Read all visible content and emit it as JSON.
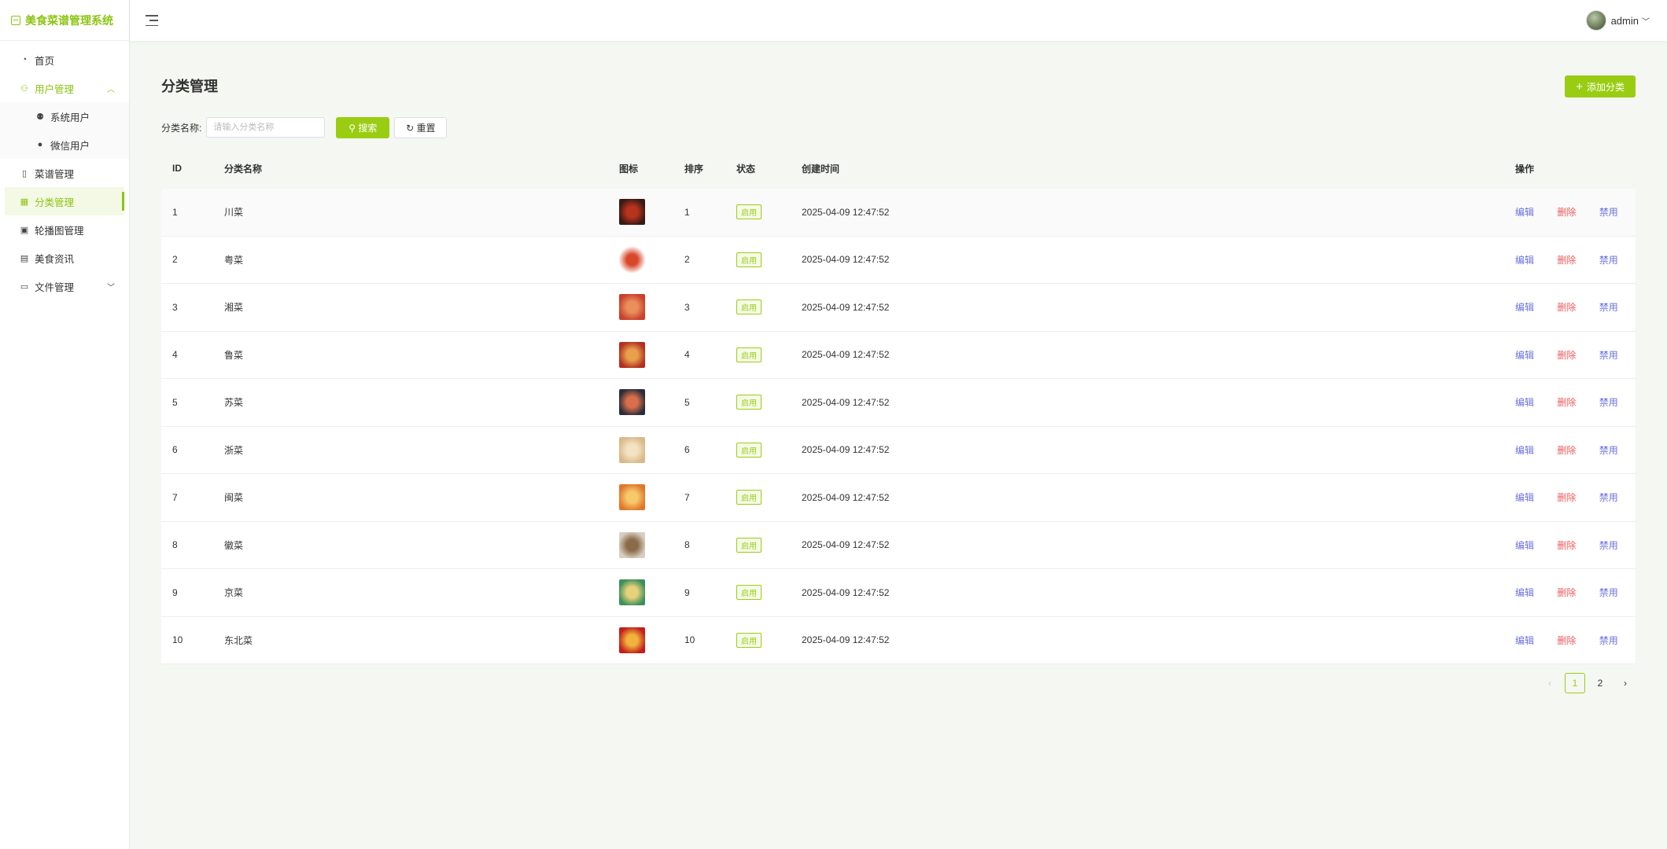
{
  "app": {
    "title": "美食菜谱管理系统"
  },
  "sidebar": {
    "items": [
      {
        "label": "首页",
        "icon": "dashboard-icon"
      },
      {
        "label": "用户管理",
        "icon": "user-icon"
      },
      {
        "label": "系统用户",
        "icon": "users-icon"
      },
      {
        "label": "微信用户",
        "icon": "wechat-icon"
      },
      {
        "label": "菜谱管理",
        "icon": "book-icon"
      },
      {
        "label": "分类管理",
        "icon": "grid-icon"
      },
      {
        "label": "轮播图管理",
        "icon": "image-icon"
      },
      {
        "label": "美食资讯",
        "icon": "document-icon"
      },
      {
        "label": "文件管理",
        "icon": "folder-icon"
      }
    ]
  },
  "header": {
    "username": "admin"
  },
  "page": {
    "title": "分类管理",
    "add_label": "添加分类"
  },
  "search": {
    "label": "分类名称:",
    "placeholder": "请输入分类名称",
    "value": "",
    "search_label": "搜索",
    "reset_label": "重置"
  },
  "table": {
    "columns": [
      "ID",
      "分类名称",
      "图标",
      "排序",
      "状态",
      "创建时间",
      "操作"
    ],
    "rows": [
      {
        "id": "1",
        "name": "川菜",
        "sort": "1",
        "status": "启用",
        "created": "2025-04-09 12:47:52",
        "colors": [
          "#3a1a14",
          "#b8331c"
        ]
      },
      {
        "id": "2",
        "name": "粤菜",
        "sort": "2",
        "status": "启用",
        "created": "2025-04-09 12:47:52",
        "colors": [
          "#ffffff",
          "#d9472b"
        ]
      },
      {
        "id": "3",
        "name": "湘菜",
        "sort": "3",
        "status": "启用",
        "created": "2025-04-09 12:47:52",
        "colors": [
          "#c9412c",
          "#e98f5c"
        ]
      },
      {
        "id": "4",
        "name": "鲁菜",
        "sort": "4",
        "status": "启用",
        "created": "2025-04-09 12:47:52",
        "colors": [
          "#b23020",
          "#e8a04c"
        ]
      },
      {
        "id": "5",
        "name": "苏菜",
        "sort": "5",
        "status": "启用",
        "created": "2025-04-09 12:47:52",
        "colors": [
          "#2b2d3a",
          "#d96f4a"
        ]
      },
      {
        "id": "6",
        "name": "浙菜",
        "sort": "6",
        "status": "启用",
        "created": "2025-04-09 12:47:52",
        "colors": [
          "#d9b98a",
          "#f4e2c2"
        ]
      },
      {
        "id": "7",
        "name": "闽菜",
        "sort": "7",
        "status": "启用",
        "created": "2025-04-09 12:47:52",
        "colors": [
          "#e0782c",
          "#f6c96a"
        ]
      },
      {
        "id": "8",
        "name": "徽菜",
        "sort": "8",
        "status": "启用",
        "created": "2025-04-09 12:47:52",
        "colors": [
          "#d8cfc0",
          "#8b6a4a"
        ]
      },
      {
        "id": "9",
        "name": "京菜",
        "sort": "9",
        "status": "启用",
        "created": "2025-04-09 12:47:52",
        "colors": [
          "#3f8f5a",
          "#e6d27a"
        ]
      },
      {
        "id": "10",
        "name": "东北菜",
        "sort": "10",
        "status": "启用",
        "created": "2025-04-09 12:47:52",
        "colors": [
          "#c21f1a",
          "#f1b33c"
        ]
      }
    ],
    "actions": {
      "edit": "编辑",
      "delete": "删除",
      "disable": "禁用"
    }
  },
  "pagination": {
    "pages": [
      "1",
      "2"
    ],
    "current": "1"
  }
}
